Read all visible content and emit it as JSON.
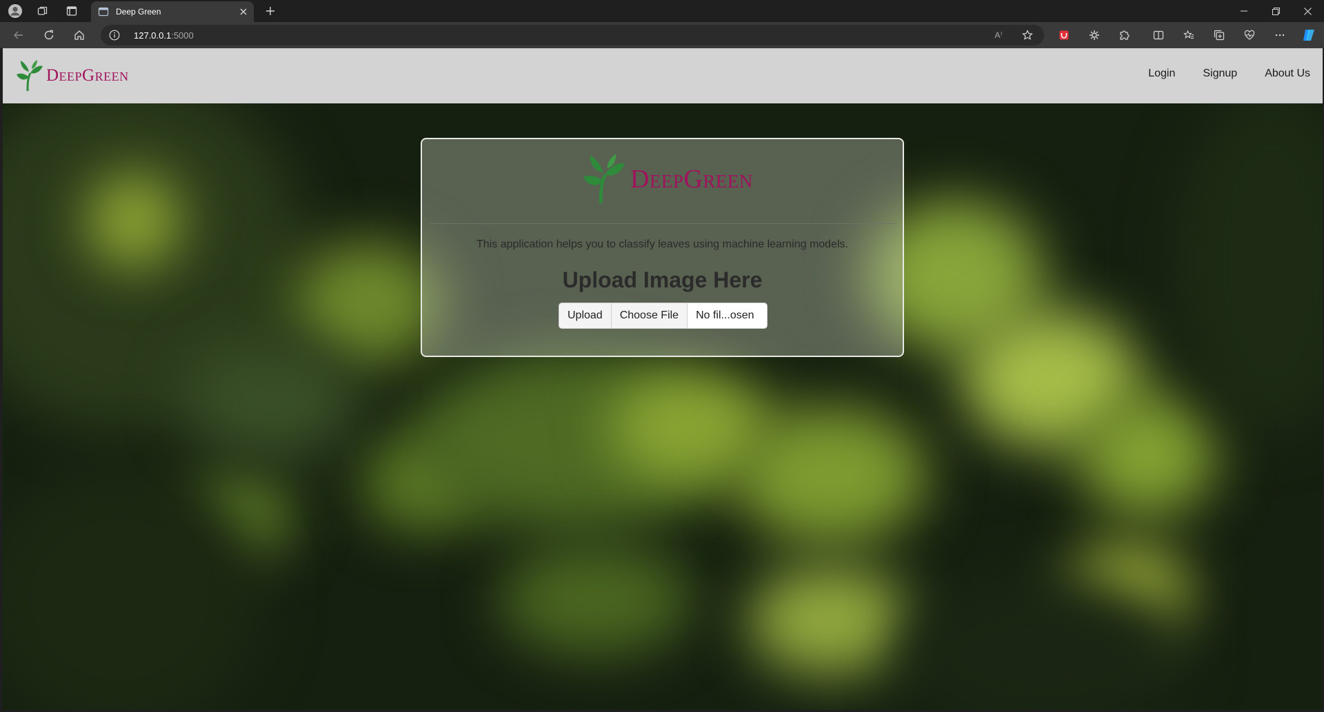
{
  "browser": {
    "tab_title": "Deep Green",
    "url_host": "127.0.0.1",
    "url_port": ":5000",
    "icons": [
      "profile-icon",
      "workspaces-icon",
      "tab-actions-icon",
      "page-icon",
      "close-icon",
      "plus-icon",
      "minimize-icon",
      "restore-icon",
      "close-window-icon",
      "back-icon",
      "refresh-icon",
      "home-icon",
      "info-icon",
      "read-aloud-icon",
      "favorite-star-icon",
      "extension-icons",
      "split-screen-icon",
      "favorites-icon",
      "collections-icon",
      "browser-essentials-icon",
      "more-icon",
      "copilot-icon"
    ],
    "read_aloud_label": "A⁾"
  },
  "navbar": {
    "brand": "DeepGreen",
    "links": [
      "Login",
      "Signup",
      "About Us"
    ]
  },
  "card": {
    "brand": "DeepGreen",
    "description": "This application helps you to classify leaves using machine learning models.",
    "heading": "Upload Image Here",
    "upload_label": "Upload",
    "choose_file_label": "Choose File",
    "file_status": "No fil...osen"
  },
  "colors": {
    "brand_text": "#a0135c",
    "leaf_green": "#2e8b3a",
    "navbar_bg": "#d4d3d3"
  }
}
